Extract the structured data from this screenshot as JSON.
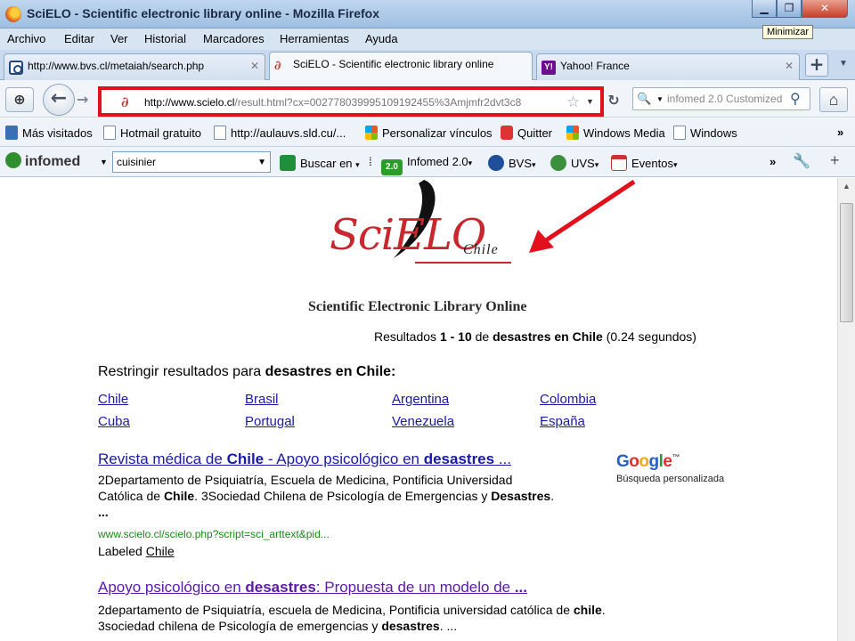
{
  "window": {
    "title": "SciELO - Scientific electronic library online - Mozilla Firefox",
    "tooltip": "Minimizar"
  },
  "menu": [
    "Archivo",
    "Editar",
    "Ver",
    "Historial",
    "Marcadores",
    "Herramientas",
    "Ayuda"
  ],
  "tabs": [
    {
      "label": "http://www.bvs.cl/metaiah/search.php",
      "active": false
    },
    {
      "label": "SciELO - Scientific electronic library online",
      "active": true
    },
    {
      "label": "Yahoo! France",
      "active": false
    }
  ],
  "nav": {
    "url_host": "http://www.scielo.cl",
    "url_rest": "/result.html?cx=002778039995109192455%3Amjmfr2dvt3c8",
    "search_placeholder": "infomed 2.0 Customized"
  },
  "bookmarks": [
    "Más visitados",
    "Hotmail gratuito",
    "http://aulauvs.sld.cu/...",
    "Personalizar vínculos",
    "Quitter",
    "Windows Media",
    "Windows"
  ],
  "infomed_toolbar": {
    "brand": "infomed",
    "search_value": "cuisinier",
    "buscar": "Buscar en",
    "badge": "2.0",
    "items": [
      "Infomed 2.0",
      "BVS",
      "UVS",
      "Eventos"
    ]
  },
  "page": {
    "logo_sci": "SciELO",
    "logo_chile": "Chile",
    "tagline": "Scientific Electronic Library Online",
    "results": {
      "prefix": "Resultados ",
      "range": "1 - 10",
      "of": " de ",
      "query": "desastres en Chile",
      "time_bold": " (0.24",
      "time_rest": " segundos)"
    },
    "restrict_prefix": "Restringir resultados para ",
    "restrict_query": "desastres en Chile:",
    "countries": [
      "Chile",
      "Brasil",
      "Argentina",
      "Colombia",
      "Cuba",
      "Portugal",
      "Venezuela",
      "España"
    ],
    "google_sub": "Búsqueda personalizada",
    "result1": {
      "t1": "Revista médica de ",
      "t2": "Chile",
      "t3": " - Apoyo psicológico en ",
      "t4": "desastres",
      "t5": " ...",
      "s1": "2Departamento de Psiquiatría, Escuela de Medicina, Pontificia Universidad",
      "s2a": "Católica de ",
      "s2b": "Chile",
      "s2c": ". 3Sociedad Chilena de Psicología de Emergencias y ",
      "s2d": "Desastres",
      "s2e": ".",
      "s3": "...",
      "url": "www.scielo.cl/scielo.php?script=sci_arttext&pid...",
      "labeled": "Labeled ",
      "label_link": "Chile"
    },
    "result2": {
      "t1": "Apoyo psicológico en ",
      "t2": "desastres",
      "t3": ": Propuesta de un modelo de ",
      "t4": "...",
      "s1a": "2departamento de Psiquiatría, escuela de Medicina, Pontificia universidad católica de ",
      "s1b": "chile",
      "s1c": ".",
      "s2a": "3sociedad chilena de Psicología de emergencias y ",
      "s2b": "desastres",
      "s2c": ". ..."
    }
  }
}
